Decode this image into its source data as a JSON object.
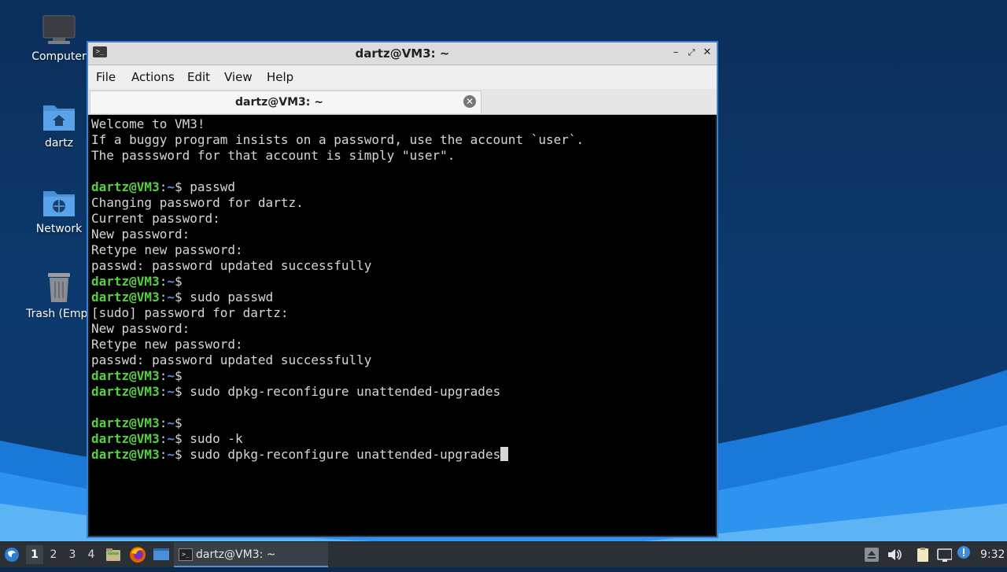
{
  "desktop": {
    "icons": [
      {
        "label": "Computer",
        "icon": "computer-icon"
      },
      {
        "label": "dartz",
        "icon": "home-folder-icon"
      },
      {
        "label": "Network",
        "icon": "network-folder-icon"
      },
      {
        "label": "Trash (Empt",
        "icon": "trash-icon"
      }
    ]
  },
  "window": {
    "title": "dartz@VM3: ~",
    "menu": [
      "File",
      "Actions",
      "Edit",
      "View",
      "Help"
    ],
    "tab_label": "dartz@VM3: ~"
  },
  "terminal": {
    "prompt_user": "dartz@VM3",
    "prompt_sep": ":",
    "prompt_path": "~",
    "prompt_end": "$",
    "lines": [
      {
        "type": "out",
        "text": "Welcome to VM3!"
      },
      {
        "type": "out",
        "text": "If a buggy program insists on a password, use the account `user`."
      },
      {
        "type": "out",
        "text": "The passsword for that account is simply \"user\"."
      },
      {
        "type": "out",
        "text": ""
      },
      {
        "type": "cmd",
        "text": " passwd"
      },
      {
        "type": "out",
        "text": "Changing password for dartz."
      },
      {
        "type": "out",
        "text": "Current password:"
      },
      {
        "type": "out",
        "text": "New password:"
      },
      {
        "type": "out",
        "text": "Retype new password:"
      },
      {
        "type": "out",
        "text": "passwd: password updated successfully"
      },
      {
        "type": "cmd",
        "text": ""
      },
      {
        "type": "cmd",
        "text": " sudo passwd"
      },
      {
        "type": "out",
        "text": "[sudo] password for dartz:"
      },
      {
        "type": "out",
        "text": "New password:"
      },
      {
        "type": "out",
        "text": "Retype new password:"
      },
      {
        "type": "out",
        "text": "passwd: password updated successfully"
      },
      {
        "type": "cmd",
        "text": ""
      },
      {
        "type": "cmd",
        "text": " sudo dpkg-reconfigure unattended-upgrades"
      },
      {
        "type": "out",
        "text": ""
      },
      {
        "type": "cmd",
        "text": ""
      },
      {
        "type": "cmd",
        "text": " sudo -k"
      },
      {
        "type": "cmd",
        "text": " sudo dpkg-reconfigure unattended-upgrades",
        "cursor": true
      }
    ]
  },
  "taskbar": {
    "workspaces": [
      "1",
      "2",
      "3",
      "4"
    ],
    "active_workspace": "1",
    "task_label": "dartz@VM3: ~",
    "clock": "9:32"
  },
  "colors": {
    "prompt_user": "#55d13f",
    "prompt_path": "#5c8fe0",
    "window_border": "#3b7fd0",
    "terminal_bg": "#000000"
  }
}
